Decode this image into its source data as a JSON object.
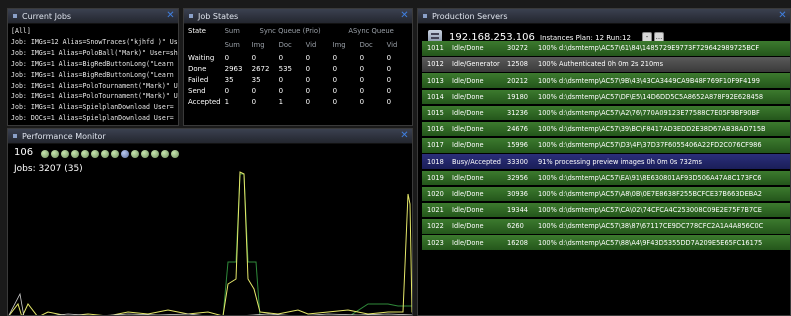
{
  "current_jobs": {
    "title": "Current Jobs",
    "items": [
      "[All]",
      "Job: IMGs=12 Alias=SnowTraces(\"kjhfd )\" Use",
      "Job: IMGs=1 Alias=PoloBall(\"Mark)\" User=shc",
      "Job: IMGs=1 Alias=BigRedButtonLong(\"Learn",
      "Job: IMGs=1 Alias=BigRedButtonLong(\"Learn",
      "Job: IMGs=1 Alias=PoloTournament(\"Mark)\" U",
      "Job: IMGs=1 Alias=PoloTournament(\"Mark)\" U",
      "Job: IMGs=1 Alias=SpielplanDownload User=",
      "Job: DOCs=1 Alias=SpielplanDownload User="
    ]
  },
  "job_states": {
    "title": "Job States",
    "headers_top": [
      "State",
      "Sum",
      "Sync Queue (Prio)",
      "ASync Queue"
    ],
    "headers_sub": [
      "Sum",
      "Img",
      "Doc",
      "Vid",
      "Img",
      "Doc",
      "Vid"
    ],
    "rows": [
      {
        "state": "Waiting",
        "values": [
          "0",
          "0",
          "0",
          "0",
          "0",
          "0",
          "0"
        ]
      },
      {
        "state": "Done",
        "values": [
          "2963",
          "2672",
          "535",
          "0",
          "0",
          "0",
          "0"
        ]
      },
      {
        "state": "Failed",
        "values": [
          "35",
          "35",
          "0",
          "0",
          "0",
          "0",
          "0"
        ]
      },
      {
        "state": "Send",
        "values": [
          "0",
          "0",
          "0",
          "0",
          "0",
          "0",
          "0"
        ]
      },
      {
        "state": "Accepted",
        "values": [
          "1",
          "0",
          "1",
          "0",
          "0",
          "0",
          "0"
        ]
      }
    ]
  },
  "performance_monitor": {
    "title": "Performance Monitor",
    "count": "106",
    "dots": [
      "green",
      "green",
      "green",
      "green",
      "green",
      "green",
      "green",
      "green",
      "blue",
      "green",
      "green",
      "green",
      "green",
      "green"
    ],
    "jobs_label": "Jobs: 3207 (35)"
  },
  "production_servers": {
    "title": "Production Servers",
    "ip": "192.168.253.106",
    "instances_label": "Instances Plan: 12 Run:12",
    "btn_minus": "-",
    "btn_more": "...",
    "rows": [
      {
        "id": "1011",
        "status": "Idle/Done",
        "port": "30272",
        "msg": "100% d:\\dsmtemp\\AC57\\61\\84\\1485729E9773F729642989725BCF",
        "kind": "done"
      },
      {
        "id": "1012",
        "status": "Idle/Generator",
        "port": "12508",
        "msg": "100% Authenticated                0h 0m 2s 210ms",
        "kind": "auth"
      },
      {
        "id": "1013",
        "status": "Idle/Done",
        "port": "20212",
        "msg": "100% d:\\dsmtemp\\AC57\\9B\\43\\43CA3449CA9B48F769F10F9F4199",
        "kind": "done"
      },
      {
        "id": "1014",
        "status": "Idle/Done",
        "port": "19180",
        "msg": "100% d:\\dsmtemp\\AC57\\DF\\E5\\14D6DD5C5A8652A878F92E628458",
        "kind": "done"
      },
      {
        "id": "1015",
        "status": "Idle/Done",
        "port": "31236",
        "msg": "100% d:\\dsmtemp\\AC57\\A2\\76\\770A09123E77588C7E05F9BF90BF",
        "kind": "done"
      },
      {
        "id": "1016",
        "status": "Idle/Done",
        "port": "24676",
        "msg": "100% d:\\dsmtemp\\AC57\\39\\BC\\F8417AD3EDD2E38D67AB38AD715B",
        "kind": "done"
      },
      {
        "id": "1017",
        "status": "Idle/Done",
        "port": "15996",
        "msg": "100% d:\\dsmtemp\\AC57\\D3\\4F\\37D37F6055406A22FD2C076CF986",
        "kind": "done"
      },
      {
        "id": "1018",
        "status": "Busy/Accepted",
        "port": "33300",
        "msg": "91% processing preview images  0h 0m 0s 732ms",
        "kind": "busy"
      },
      {
        "id": "1019",
        "status": "Idle/Done",
        "port": "32956",
        "msg": "100% d:\\dsmtemp\\AC57\\EA\\91\\8E630801AF93D506A47A8C173FC6",
        "kind": "done"
      },
      {
        "id": "1020",
        "status": "Idle/Done",
        "port": "30936",
        "msg": "100% d:\\dsmtemp\\AC57\\A8\\0B\\0E7E8638F255BCFCE37B663DEBA2",
        "kind": "done"
      },
      {
        "id": "1021",
        "status": "Idle/Done",
        "port": "19344",
        "msg": "100% d:\\dsmtemp\\AC57\\CA\\02\\74CFCA4C253008C09E2E75F7B7CE",
        "kind": "done"
      },
      {
        "id": "1022",
        "status": "Idle/Done",
        "port": "6260",
        "msg": "100% d:\\dsmtemp\\AC57\\38\\87\\67117CE9DC778CFC2A1A4A856C0C",
        "kind": "done"
      },
      {
        "id": "1023",
        "status": "Idle/Done",
        "port": "16208",
        "msg": "100% d:\\dsmtemp\\AC57\\88\\A4\\9F43D5355DD7A209E5E65FC16175",
        "kind": "done"
      }
    ]
  }
}
